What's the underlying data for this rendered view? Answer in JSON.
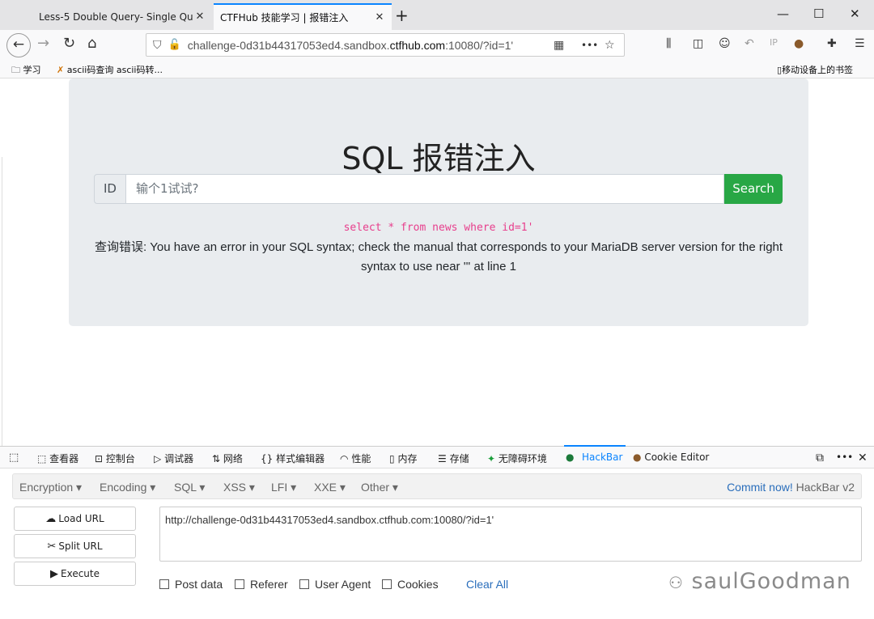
{
  "tabs": [
    {
      "title": "Less-5 Double Query- Single Qu",
      "close": "✕"
    },
    {
      "title": "CTFHub 技能学习 | 报错注入",
      "close": "✕"
    }
  ],
  "new_tab": "+",
  "window_controls": {
    "minimize": "—",
    "maximize": "☐",
    "close": "✕"
  },
  "nav": {
    "url_prefix": "challenge-0d31b44317053ed4.sandbox.",
    "url_domain": "ctfhub.com",
    "url_suffix": ":10080/?id=1'",
    "more": "•••"
  },
  "bookmarks": [
    {
      "label": "学习"
    },
    {
      "label": "ascii码查询 ascii码转..."
    }
  ],
  "mobile_bookmarks": "移动设备上的书签",
  "page": {
    "title": "SQL 报错注入",
    "id_label": "ID",
    "input_placeholder": "输个1试试?",
    "search_label": "Search",
    "sql": "select * from news where id=1'",
    "error": "查询错误: You have an error in your SQL syntax; check the manual that corresponds to your MariaDB server version for the right syntax to use near ''' at line 1"
  },
  "devtools": {
    "tabs": [
      "查看器",
      "控制台",
      "调试器",
      "网络",
      "样式编辑器",
      "性能",
      "内存",
      "存储",
      "无障碍环境",
      "HackBar",
      "Cookie Editor"
    ],
    "active": "HackBar",
    "more": "•••",
    "close": "✕"
  },
  "hackbar": {
    "menu": [
      "Encryption ▾",
      "Encoding ▾",
      "SQL ▾",
      "XSS ▾",
      "LFI ▾",
      "XXE ▾",
      "Other ▾"
    ],
    "commit": "Commit now!",
    "version": "HackBar v2",
    "buttons": {
      "load": "Load URL",
      "split": "Split URL",
      "execute": "Execute"
    },
    "url_value": "http://challenge-0d31b44317053ed4.sandbox.ctfhub.com:10080/?id=1'",
    "checkboxes": [
      "Post data",
      "Referer",
      "User Agent",
      "Cookies"
    ],
    "clear_all": "Clear All"
  },
  "watermark": "saulGoodman"
}
